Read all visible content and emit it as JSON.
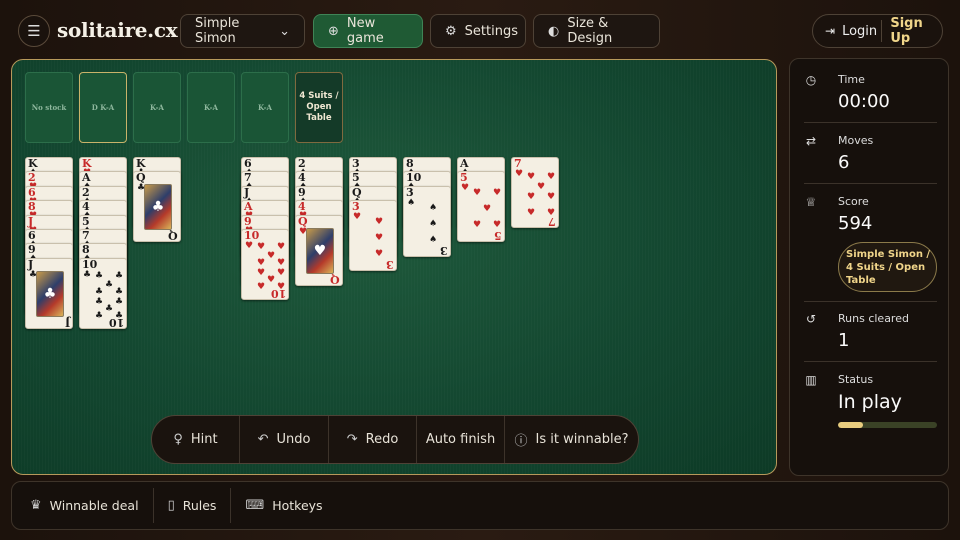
{
  "app": {
    "logo": "solitaire.cx"
  },
  "header": {
    "game_select": "Simple Simon",
    "new_game": "New game",
    "settings": "Settings",
    "size_design": "Size & Design",
    "login": "Login",
    "signup": "Sign Up"
  },
  "foundations": [
    {
      "label": "No stock"
    },
    {
      "label": "D K-A"
    },
    {
      "label": "K-A"
    },
    {
      "label": "K-A"
    },
    {
      "label": "K-A"
    },
    {
      "label": "4 Suits / Open Table"
    }
  ],
  "tableau": [
    [
      {
        "rank": "K",
        "suit": "♠",
        "color": "blk"
      },
      {
        "rank": "2",
        "suit": "♥",
        "color": "red"
      },
      {
        "rank": "6",
        "suit": "♥",
        "color": "red"
      },
      {
        "rank": "8",
        "suit": "♥",
        "color": "red"
      },
      {
        "rank": "J",
        "suit": "♥",
        "color": "red"
      },
      {
        "rank": "6",
        "suit": "♠",
        "color": "blk"
      },
      {
        "rank": "9",
        "suit": "♠",
        "color": "blk"
      },
      {
        "rank": "J",
        "suit": "♣",
        "color": "blk",
        "face": true
      }
    ],
    [
      {
        "rank": "K",
        "suit": "♥",
        "color": "red"
      },
      {
        "rank": "A",
        "suit": "♠",
        "color": "blk"
      },
      {
        "rank": "2",
        "suit": "♠",
        "color": "blk"
      },
      {
        "rank": "4",
        "suit": "♠",
        "color": "blk"
      },
      {
        "rank": "5",
        "suit": "♠",
        "color": "blk"
      },
      {
        "rank": "7",
        "suit": "♠",
        "color": "blk"
      },
      {
        "rank": "8",
        "suit": "♠",
        "color": "blk"
      },
      {
        "rank": "10",
        "suit": "♣",
        "color": "blk",
        "pips": 10
      }
    ],
    [
      {
        "rank": "K",
        "suit": "♣",
        "color": "blk"
      },
      {
        "rank": "Q",
        "suit": "♣",
        "color": "blk",
        "face": true
      }
    ],
    [],
    [
      {
        "rank": "6",
        "suit": "♠",
        "color": "blk"
      },
      {
        "rank": "7",
        "suit": "♠",
        "color": "blk"
      },
      {
        "rank": "J",
        "suit": "♠",
        "color": "blk"
      },
      {
        "rank": "A",
        "suit": "♥",
        "color": "red"
      },
      {
        "rank": "9",
        "suit": "♥",
        "color": "red"
      },
      {
        "rank": "10",
        "suit": "♥",
        "color": "red",
        "pips": 10
      }
    ],
    [
      {
        "rank": "2",
        "suit": "♠",
        "color": "blk"
      },
      {
        "rank": "4",
        "suit": "♠",
        "color": "blk"
      },
      {
        "rank": "9",
        "suit": "♠",
        "color": "blk"
      },
      {
        "rank": "4",
        "suit": "♥",
        "color": "red"
      },
      {
        "rank": "Q",
        "suit": "♥",
        "color": "red",
        "face": true
      }
    ],
    [
      {
        "rank": "3",
        "suit": "♠",
        "color": "blk"
      },
      {
        "rank": "5",
        "suit": "♠",
        "color": "blk"
      },
      {
        "rank": "Q",
        "suit": "♠",
        "color": "blk"
      },
      {
        "rank": "3",
        "suit": "♥",
        "color": "red",
        "pips": 3
      }
    ],
    [
      {
        "rank": "8",
        "suit": "♠",
        "color": "blk"
      },
      {
        "rank": "10",
        "suit": "♠",
        "color": "blk"
      },
      {
        "rank": "3",
        "suit": "♠",
        "color": "blk",
        "pips": 3
      }
    ],
    [
      {
        "rank": "A",
        "suit": "♠",
        "color": "blk"
      },
      {
        "rank": "5",
        "suit": "♥",
        "color": "red",
        "pips": 5
      }
    ],
    [
      {
        "rank": "7",
        "suit": "♥",
        "color": "red",
        "pips": 7
      }
    ]
  ],
  "controls": {
    "hint": "Hint",
    "undo": "Undo",
    "redo": "Redo",
    "auto_finish": "Auto finish",
    "winnable": "Is it winnable?"
  },
  "stats": {
    "time_label": "Time",
    "time_value": "00:00",
    "moves_label": "Moves",
    "moves_value": "6",
    "score_label": "Score",
    "score_value": "594",
    "mode_pill": "Simple Simon / 4 Suits / Open Table",
    "runs_label": "Runs cleared",
    "runs_value": "1",
    "status_label": "Status",
    "status_value": "In play",
    "progress": 0.25
  },
  "footer": {
    "winnable_deal": "Winnable deal",
    "rules": "Rules",
    "hotkeys": "Hotkeys"
  },
  "colors": {
    "accent_green": "#1f5a34",
    "gold": "#f0d58a",
    "felt": "#134730"
  }
}
